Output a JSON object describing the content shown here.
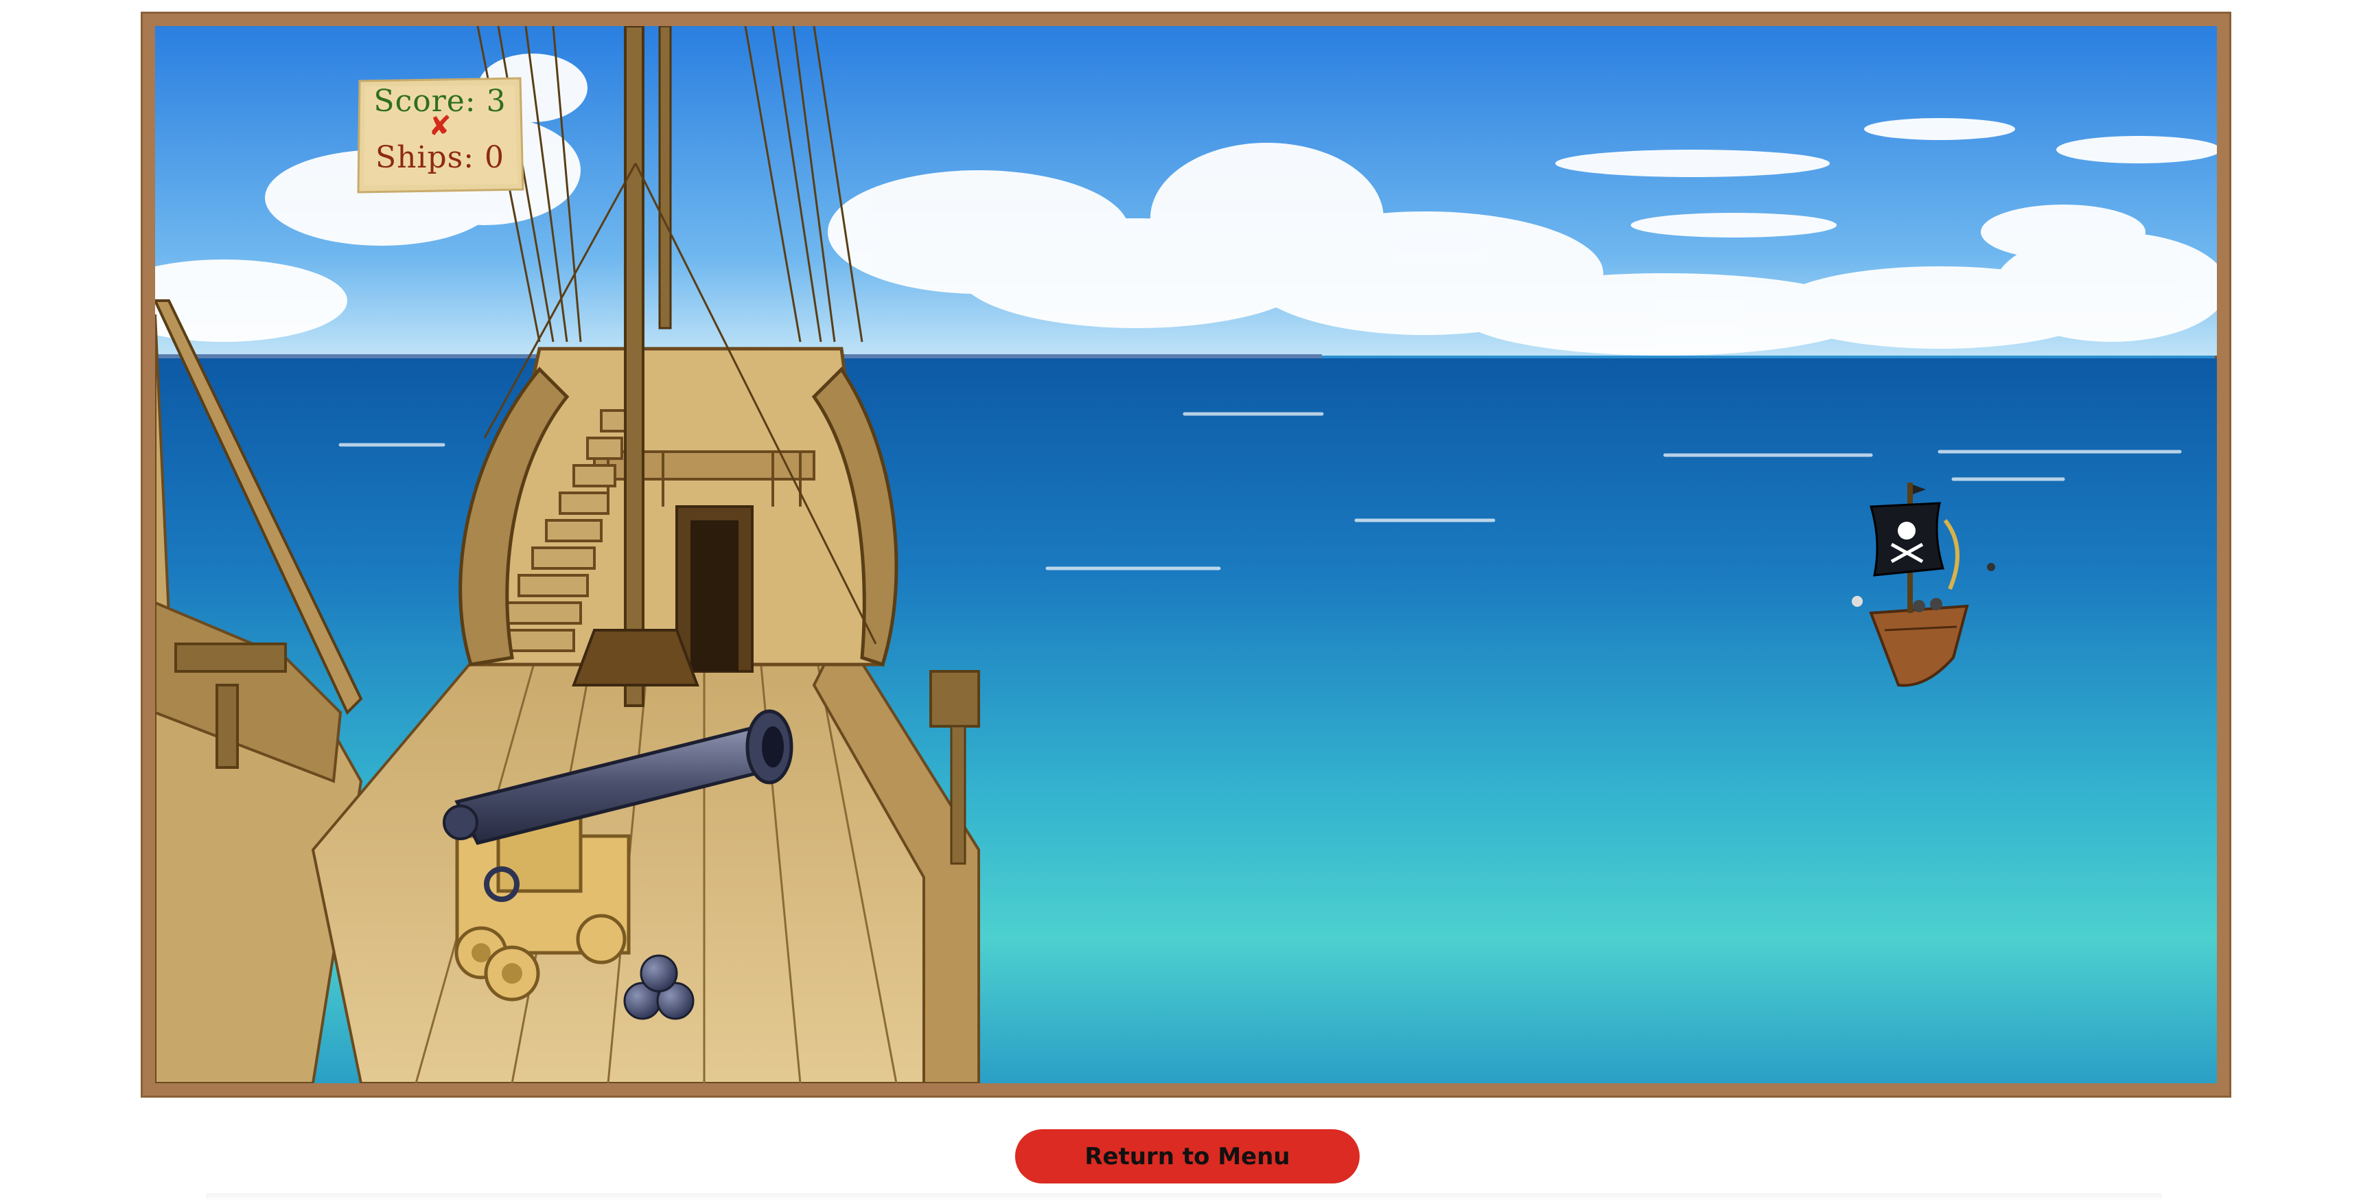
{
  "hud": {
    "score_label": "Score: 3",
    "miss_mark": "✘",
    "ships_label": "Ships: 0"
  },
  "controls": {
    "return_label": "Return to Menu"
  },
  "colors": {
    "frame": "#a9794f",
    "button": "#db2b22",
    "score_text": "#2e6e1f",
    "ships_text": "#8e2a14",
    "sea_deep": "#1d6fb8",
    "sea_shallow": "#4fd0d0",
    "sky": "#3a8fe0"
  },
  "icons": {
    "cannon": "cannon-icon",
    "cannonballs": "cannonball-stack-icon",
    "enemy_ship": "pirate-ship-icon",
    "jolly_roger": "skull-crossbones-icon"
  }
}
